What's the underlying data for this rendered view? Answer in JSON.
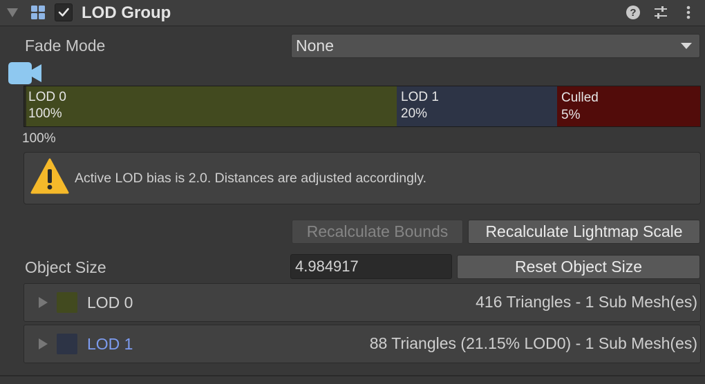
{
  "header": {
    "title": "LOD Group",
    "enabled": true
  },
  "colors": {
    "lod0": "#424a1f",
    "lod1": "#2d3446",
    "culled": "#520c0a",
    "link_blue": "#7d9cf0",
    "warning_yellow": "#f5b92a"
  },
  "icons": {
    "fold": "triangle-down",
    "component": "lod-group-icon",
    "help": "question-circle",
    "presets": "sliders",
    "menu": "vertical-dots",
    "camera": "video-camera",
    "warning": "warning-triangle"
  },
  "fade_mode": {
    "label": "Fade Mode",
    "value": "None"
  },
  "lod_bar": {
    "segments": [
      {
        "name": "LOD 0",
        "percent": "100%",
        "fraction": 0.55
      },
      {
        "name": "LOD 1",
        "percent": "20%",
        "fraction": 0.24
      },
      {
        "name": "Culled",
        "percent": "5%",
        "fraction": 0.21
      }
    ],
    "camera_percent": "100%"
  },
  "warning": {
    "text": "Active LOD bias is 2.0. Distances are adjusted accordingly."
  },
  "buttons": {
    "recalc_bounds": "Recalculate Bounds",
    "recalc_lightmap": "Recalculate Lightmap Scale",
    "reset_size": "Reset Object Size"
  },
  "object_size": {
    "label": "Object Size",
    "value": "4.984917"
  },
  "lod_list": [
    {
      "name": "LOD 0",
      "info": "416 Triangles  - 1 Sub Mesh(es)"
    },
    {
      "name": "LOD 1",
      "info": "88 Triangles (21.15% LOD0) - 1 Sub Mesh(es)"
    }
  ]
}
